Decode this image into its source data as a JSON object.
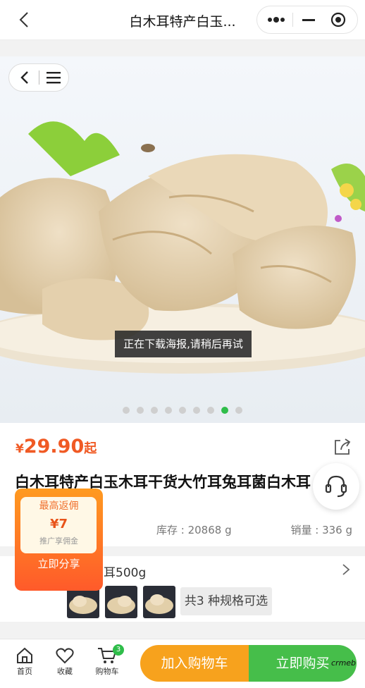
{
  "header": {
    "title": "白木耳特产白玉...",
    "icons": [
      "back-icon",
      "more-dots-icon",
      "minimize-icon",
      "close-target-icon"
    ]
  },
  "gallery": {
    "toast": "正在下载海报,请稍后再试",
    "dot_count": 9,
    "active_dot": 8,
    "nav_icons": [
      "back-icon",
      "menu-icon"
    ]
  },
  "product": {
    "price_symbol": "¥",
    "price": "29.90",
    "price_suffix": "起",
    "title": "白木耳特产白玉木耳干货大竹耳兔耳菌白木耳",
    "stock": "库存 : 20868 g",
    "sales": "销量 : 336 g"
  },
  "spec": {
    "selected_name": "耳500g",
    "count_label": "共3 种规格可选"
  },
  "commission": {
    "title": "最高返佣",
    "amount": "¥7",
    "subtitle": "推广享佣金",
    "button_label": "立即分享"
  },
  "bottom": {
    "tabs": [
      {
        "label": "首页",
        "icon": "home-icon"
      },
      {
        "label": "收藏",
        "icon": "heart-icon"
      },
      {
        "label": "购物车",
        "icon": "cart-icon"
      }
    ],
    "cart_badge": "3",
    "add_to_cart": "加入购物车",
    "buy_now": "立即购买",
    "watermark": "crmeb"
  },
  "colors": {
    "accent_green": "#2fbd4a",
    "price_orange": "#f05a24",
    "cart_button": "#f7a21d",
    "buy_button": "#46be4a"
  }
}
